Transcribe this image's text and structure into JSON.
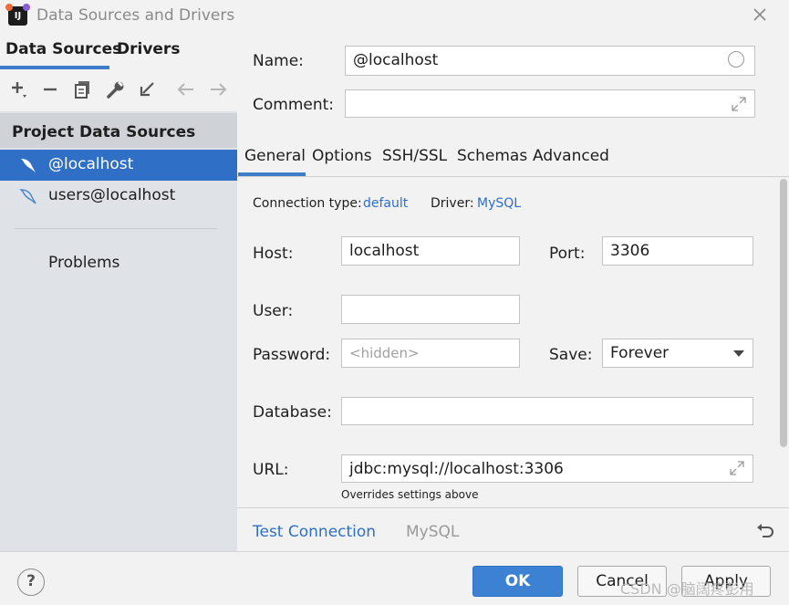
{
  "window": {
    "title": "Data Sources and Drivers"
  },
  "left_panel": {
    "tabs": [
      {
        "label": "Data Sources"
      },
      {
        "label": "Drivers"
      }
    ],
    "section_title": "Project Data Sources",
    "items": [
      {
        "label": "@localhost",
        "selected": true
      },
      {
        "label": "users@localhost",
        "selected": false
      }
    ],
    "problems_label": "Problems"
  },
  "form": {
    "name_label": "Name:",
    "name_value": "@localhost",
    "comment_label": "Comment:",
    "comment_value": ""
  },
  "tabs": [
    {
      "label": "General"
    },
    {
      "label": "Options"
    },
    {
      "label": "SSH/SSL"
    },
    {
      "label": "Schemas"
    },
    {
      "label": "Advanced"
    }
  ],
  "general": {
    "connection_type_label": "Connection type:",
    "connection_type_value": "default",
    "driver_label": "Driver:",
    "driver_value": "MySQL",
    "host_label": "Host:",
    "host_value": "localhost",
    "port_label": "Port:",
    "port_value": "3306",
    "user_label": "User:",
    "user_value": "",
    "password_label": "Password:",
    "password_placeholder": "<hidden>",
    "save_label": "Save:",
    "save_value": "Forever",
    "database_label": "Database:",
    "database_value": "",
    "url_label": "URL:",
    "url_value": "jdbc:mysql://localhost:3306",
    "url_hint": "Overrides settings above"
  },
  "bottom_bar": {
    "test_connection": "Test Connection",
    "driver_name": "MySQL"
  },
  "footer": {
    "help": "?",
    "ok": "OK",
    "cancel": "Cancel",
    "apply": "Apply"
  },
  "watermark": "CSDN @脑阔疼彭用",
  "colors": {
    "accent": "#2f6fc6",
    "selection": "#2f6fc6",
    "link": "#2f6fc6"
  }
}
